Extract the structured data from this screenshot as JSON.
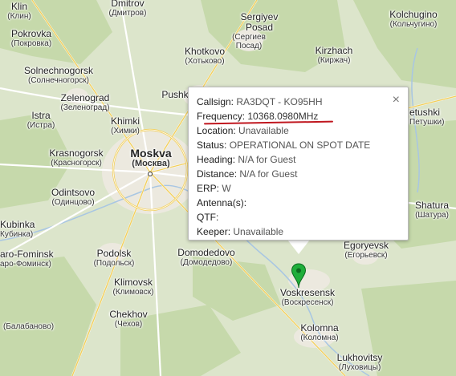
{
  "map": {
    "colors": {
      "land": "#dfe6cf",
      "forest": "#c9dbb0",
      "urban": "#f1ede3",
      "road": "#ffffff",
      "highway": "#f7d96b"
    },
    "places": [
      {
        "id": "klin",
        "name": "Klin",
        "ru": "(Клин)"
      },
      {
        "id": "dmitrov",
        "name": "Dmitrov",
        "ru": "(Дмитров)"
      },
      {
        "id": "sergiyev",
        "name": "Sergiyev",
        "ru": "Posad"
      },
      {
        "id": "sergiyev2",
        "name": "(Сергиев",
        "ru": "Посад)"
      },
      {
        "id": "kolchugino",
        "name": "Kolchugino",
        "ru": "(Кольчугино)"
      },
      {
        "id": "pokrovka",
        "name": "Pokrovka",
        "ru": "(Покровка)"
      },
      {
        "id": "khotkovo",
        "name": "Khotkovo",
        "ru": "(Хотьково)"
      },
      {
        "id": "kirzhach",
        "name": "Kirzhach",
        "ru": "(Киржач)"
      },
      {
        "id": "solnechnogorsk",
        "name": "Solnechnogorsk",
        "ru": "(Солнечногорск)"
      },
      {
        "id": "zelenograd",
        "name": "Zelenograd",
        "ru": "(Зеленоград)"
      },
      {
        "id": "pushkino",
        "name": "Pushk",
        "ru": ""
      },
      {
        "id": "istra",
        "name": "Istra",
        "ru": "(Истра)"
      },
      {
        "id": "khimki",
        "name": "Khimki",
        "ru": "(Химки)"
      },
      {
        "id": "petushki",
        "name": "etushki",
        "ru": "Петушки)"
      },
      {
        "id": "moskva",
        "name": "Moskva",
        "ru": "(Москва)",
        "big": true
      },
      {
        "id": "krasnogorsk",
        "name": "Krasnogorsk",
        "ru": "(Красногорск)"
      },
      {
        "id": "odintsovo",
        "name": "Odintsovo",
        "ru": "(Одинцово)"
      },
      {
        "id": "kubinka",
        "name": "Kubinka",
        "ru": "Кубинка)"
      },
      {
        "id": "shatura",
        "name": "Shatura",
        "ru": "(Шатура)"
      },
      {
        "id": "fominsk",
        "name": "aro-Fominsk",
        "ru": "аро-Фоминск)"
      },
      {
        "id": "podolsk",
        "name": "Podolsk",
        "ru": "(Подольск)"
      },
      {
        "id": "domodedovo",
        "name": "Domodedovo",
        "ru": "(Домодедово)"
      },
      {
        "id": "egoryevsk",
        "name": "Egoryevsk",
        "ru": "(Егорьевск)"
      },
      {
        "id": "klimovsk",
        "name": "Klimovsk",
        "ru": "(Климовск)"
      },
      {
        "id": "voskresensk",
        "name": "Voskresensk",
        "ru": "(Воскресенск)"
      },
      {
        "id": "chekhov",
        "name": "Chekhov",
        "ru": "(Чехов)"
      },
      {
        "id": "balabanovo",
        "name": "(Балабаново)",
        "ru": ""
      },
      {
        "id": "kolomna",
        "name": "Kolomna",
        "ru": "(Коломна)"
      },
      {
        "id": "lukhovitsy",
        "name": "Lukhovitsy",
        "ru": "(Луховицы)"
      }
    ]
  },
  "popup": {
    "close_icon": "×",
    "rows": {
      "callsign": {
        "key": "Callsign:",
        "value": "RA3DQT - KO95HH"
      },
      "frequency": {
        "key": "Frequency:",
        "value": "10368.0980MHz"
      },
      "location": {
        "key": "Location:",
        "value": "Unavailable"
      },
      "status": {
        "key": "Status:",
        "value": "OPERATIONAL ON SPOT DATE"
      },
      "heading": {
        "key": "Heading:",
        "value": "N/A for Guest"
      },
      "distance": {
        "key": "Distance:",
        "value": "N/A for Guest"
      },
      "erp": {
        "key": "ERP:",
        "value": "W"
      },
      "antenna": {
        "key": "Antenna(s):",
        "value": ""
      },
      "qtf": {
        "key": "QTF:",
        "value": ""
      },
      "keeper": {
        "key": "Keeper:",
        "value": "Unavailable"
      }
    }
  },
  "marker": {
    "icon": "map-pin-icon",
    "color": "#1fae3a"
  }
}
